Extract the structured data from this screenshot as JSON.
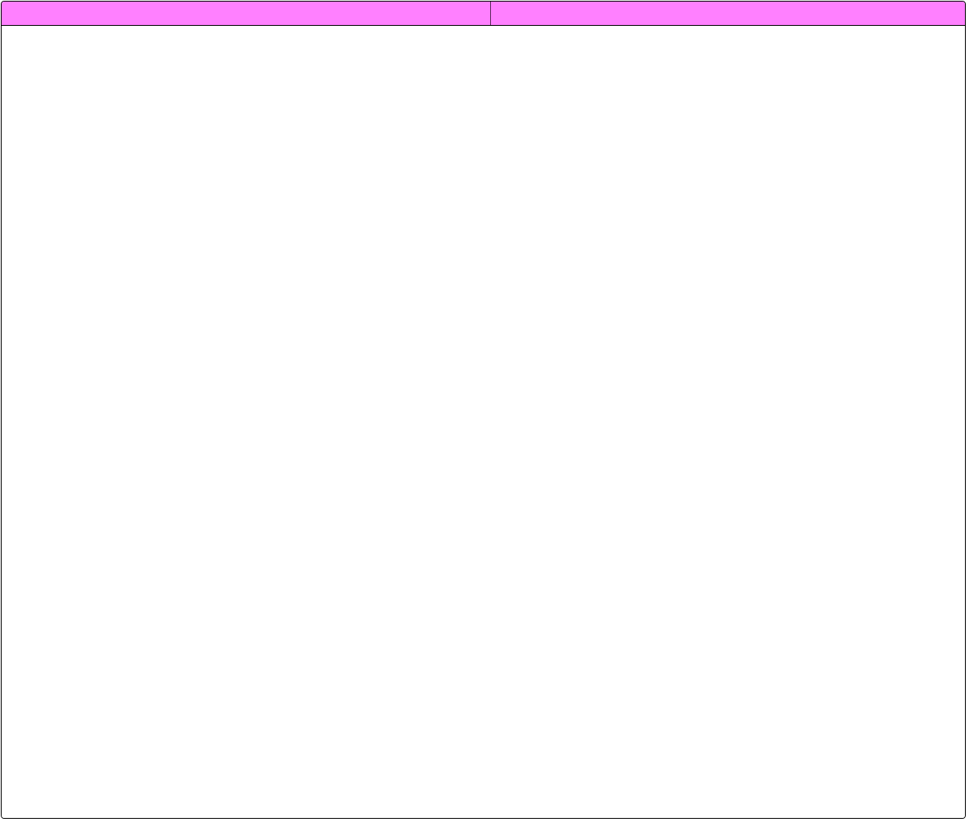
{
  "colors": {
    "header_background": "#ff80ff",
    "border": "#000000",
    "panel_background": "#ffffff"
  },
  "header": {
    "columns": [
      {
        "label": ""
      },
      {
        "label": ""
      }
    ]
  }
}
